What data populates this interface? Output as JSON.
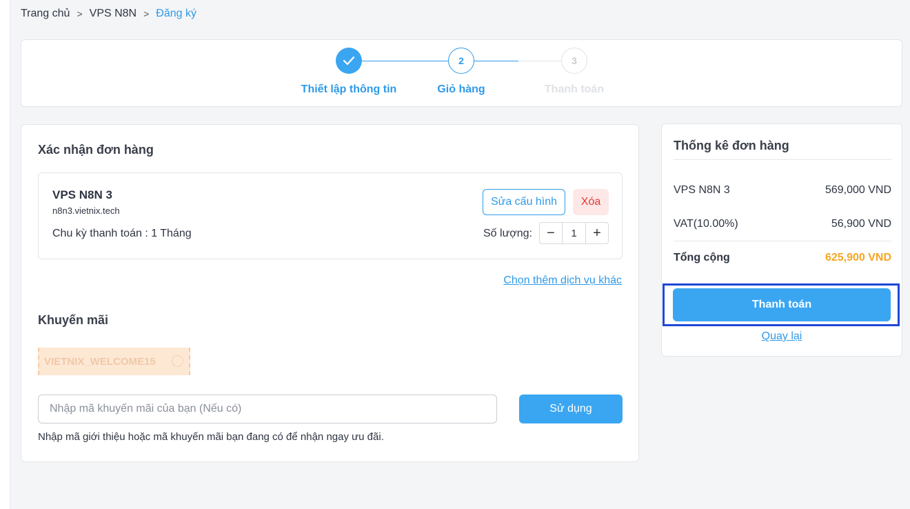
{
  "breadcrumb": {
    "items": [
      "Trang chủ",
      "VPS N8N",
      "Đăng ký"
    ],
    "separator": ">"
  },
  "stepper": {
    "steps": [
      {
        "number": "",
        "label": "Thiết lập thông tin",
        "state": "completed"
      },
      {
        "number": "2",
        "label": "Giỏ hàng",
        "state": "active"
      },
      {
        "number": "3",
        "label": "Thanh toán",
        "state": "pending"
      }
    ]
  },
  "order": {
    "title": "Xác nhận đơn hàng",
    "item": {
      "name": "VPS N8N 3",
      "domain": "n8n3.vietnix.tech",
      "cycle": "Chu kỳ thanh toán : 1 Tháng",
      "edit_label": "Sửa cấu hình",
      "delete_label": "Xóa",
      "quantity_label": "Số lượng:",
      "quantity": "1",
      "minus": "−",
      "plus": "+"
    },
    "more_services_link": "Chọn thêm dịch vụ khác"
  },
  "promo": {
    "title": "Khuyến mãi",
    "coupon_code": "VIETNIX_WELCOME15",
    "input_placeholder": "Nhập mã khuyến mãi của bạn (Nếu có)",
    "input_value": "",
    "apply_label": "Sử dụng",
    "hint": "Nhập mã giới thiệu hoặc mã khuyến mãi bạn đang có để nhận ngay ưu đãi."
  },
  "summary": {
    "title": "Thống kê đơn hàng",
    "rows": [
      {
        "label": "VPS N8N 3",
        "value": "569,000 VND"
      },
      {
        "label": "VAT(10.00%)",
        "value": "56,900 VND"
      }
    ],
    "total_label": "Tổng cộng",
    "total_value": "625,900 VND",
    "pay_label": "Thanh toán",
    "back_label": "Quay lại"
  },
  "colors": {
    "accent": "#2f9ae8",
    "button": "#3aa6f2",
    "total": "#f5a623",
    "danger": "#e53935",
    "highlight": "#1f47d6"
  }
}
